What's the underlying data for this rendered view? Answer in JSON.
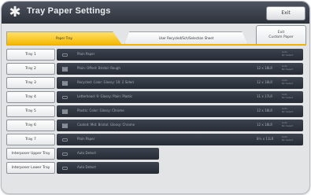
{
  "header": {
    "title": "Tray Paper Settings",
    "exit_label": "Exit",
    "exit_panel_line1": "Exit",
    "exit_panel_line2": "Custom Paper",
    "gear_icon": "gear-icon"
  },
  "tabs": [
    {
      "label": "Paper Tray",
      "active": true
    },
    {
      "label": "User Recycled/Sch/Selection Sheet",
      "active": false
    }
  ],
  "rows": [
    {
      "tray": "Tray 1",
      "icon": "plain-paper-icon",
      "desc": "Plain Paper",
      "size": "",
      "note": "Auto\nNo Select"
    },
    {
      "tray": "Tray 2",
      "icon": "special-paper-icon",
      "desc": "Plain: Offset: Bristol: Rough",
      "size": "12 x 18LR",
      "note": "Auto\nNo Select"
    },
    {
      "tray": "Tray 3",
      "icon": "special-paper-icon",
      "desc": "Recycled: Color: Glossy: 10: 2 Sided",
      "size": "12 x 18LR",
      "note": "Auto\nNo Select"
    },
    {
      "tray": "Tray 4",
      "icon": "plain-paper-icon",
      "desc": "Letterhead: 9: Glossy: Plain: Plastic",
      "size": "11 x 17LR",
      "note": "Auto\nNo Select"
    },
    {
      "tray": "Tray 5",
      "icon": "special-paper-icon",
      "desc": "Plastic: Color: Glossy: Chrome",
      "size": "12 x 18LR",
      "note": "Auto\nNo Select"
    },
    {
      "tray": "Tray 6",
      "icon": "special-paper-icon",
      "desc": "Coated: Mid: Bristol: Glossy: Chrome",
      "size": "12 x 18LR",
      "note": "Auto\nNo Select"
    },
    {
      "tray": "Tray 7",
      "icon": "plain-paper-icon",
      "desc": "Plain Paper",
      "size": "8½ x 11LR",
      "note": "Auto\nNo Select"
    },
    {
      "tray": "Interposer Upper Tray",
      "icon": "plain-paper-icon",
      "desc": "Auto Detect",
      "size": "",
      "note": ""
    },
    {
      "tray": "Interposer Lower Tray",
      "icon": "plain-paper-icon",
      "desc": "Auto Detect",
      "size": "",
      "note": ""
    }
  ]
}
